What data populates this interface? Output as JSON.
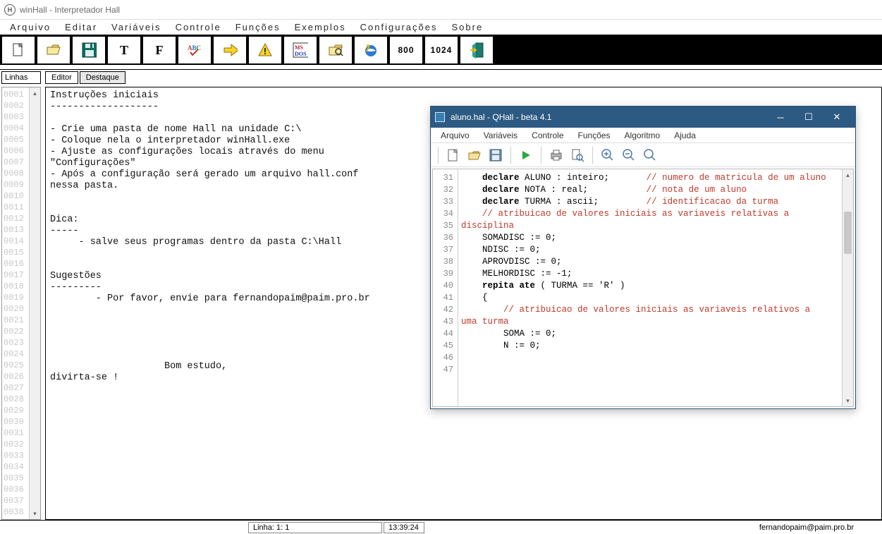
{
  "window": {
    "title": "winHall - Interpretador Hall"
  },
  "menu": [
    "Arquivo",
    "Editar",
    "Variáveis",
    "Controle",
    "Funções",
    "Exemplos",
    "Configurações",
    "Sobre"
  ],
  "toolbar": {
    "btn_800": "800",
    "btn_1024": "1024",
    "btn_T": "T",
    "btn_F": "F"
  },
  "linesTab": "Linhas",
  "lineNumbers": [
    "0001",
    "0002",
    "0003",
    "0004",
    "0005",
    "0006",
    "0007",
    "0008",
    "0009",
    "0010",
    "0011",
    "0012",
    "0013",
    "0014",
    "0015",
    "0016",
    "0017",
    "0018",
    "0019",
    "0020",
    "0021",
    "0022",
    "0023",
    "0024",
    "0025",
    "0026",
    "0027",
    "0028",
    "0029",
    "0030",
    "0031",
    "0032",
    "0033",
    "0034",
    "0035",
    "0036",
    "0037",
    "0038"
  ],
  "tabs": {
    "editor": "Editor",
    "destaque": "Destaque"
  },
  "editorText": "Instruções iniciais\n-------------------\n\n- Crie uma pasta de nome Hall na unidade C:\\\n- Coloque nela o interpretador winHall.exe\n- Ajuste as configurações locais através do menu\n\"Configurações\"\n- Após a configuração será gerado um arquivo hall.conf\nnessa pasta.\n\n\nDica:\n-----\n     - salve seus programas dentro da pasta C:\\Hall\n\n\nSugestões\n---------\n        - Por favor, envie para fernandopaim@paim.pro.br\n\n\n\n\n\n                    Bom estudo,\ndivirta-se !",
  "status": {
    "line": "Linha: 1: 1",
    "time": "13:39:24",
    "email": "fernandopaim@paim.pro.br"
  },
  "qhall": {
    "title": "aluno.hal - QHall - beta 4.1",
    "menu": [
      "Arquivo",
      "Variáveis",
      "Controle",
      "Funções",
      "Algoritmo",
      "Ajuda"
    ],
    "gutter": [
      "31",
      "32",
      "33",
      "34",
      "35",
      "36",
      "37",
      "38",
      "39",
      "40",
      "41",
      "42",
      "43",
      "44",
      "",
      "45",
      "46",
      "47"
    ],
    "code": [
      {
        "indent": "    ",
        "parts": [
          {
            "t": "declare ",
            "c": "kw"
          },
          {
            "t": "ALUNO : inteiro;",
            "c": "id"
          },
          {
            "t": "       ",
            "c": ""
          },
          {
            "t": "// numero de matricula de um aluno",
            "c": "cm"
          }
        ]
      },
      {
        "indent": "    ",
        "parts": [
          {
            "t": "declare ",
            "c": "kw"
          },
          {
            "t": "NOTA : real;",
            "c": "id"
          },
          {
            "t": "           ",
            "c": ""
          },
          {
            "t": "// nota de um aluno",
            "c": "cm"
          }
        ]
      },
      {
        "indent": "    ",
        "parts": [
          {
            "t": "declare ",
            "c": "kw"
          },
          {
            "t": "TURMA : ascii;",
            "c": "id"
          },
          {
            "t": "         ",
            "c": ""
          },
          {
            "t": "// identificacao da turma",
            "c": "cm"
          }
        ]
      },
      {
        "indent": "",
        "parts": [
          {
            "t": "",
            "c": ""
          }
        ]
      },
      {
        "indent": "    ",
        "parts": [
          {
            "t": "// atribuicao de valores iniciais as variaveis relativas a",
            "c": "cm"
          }
        ]
      },
      {
        "indent": "",
        "parts": [
          {
            "t": "disciplina",
            "c": "cm"
          }
        ]
      },
      {
        "indent": "",
        "parts": [
          {
            "t": "",
            "c": ""
          }
        ]
      },
      {
        "indent": "    ",
        "parts": [
          {
            "t": "SOMADISC := 0;",
            "c": "id"
          }
        ]
      },
      {
        "indent": "    ",
        "parts": [
          {
            "t": "NDISC := 0;",
            "c": "id"
          }
        ]
      },
      {
        "indent": "    ",
        "parts": [
          {
            "t": "APROVDISC := 0;",
            "c": "id"
          }
        ]
      },
      {
        "indent": "    ",
        "parts": [
          {
            "t": "MELHORDISC := -1;",
            "c": "id"
          }
        ]
      },
      {
        "indent": "",
        "parts": [
          {
            "t": "",
            "c": ""
          }
        ]
      },
      {
        "indent": "    ",
        "parts": [
          {
            "t": "repita ate ",
            "c": "kw"
          },
          {
            "t": "( TURMA == 'R' )",
            "c": "id"
          }
        ]
      },
      {
        "indent": "    ",
        "parts": [
          {
            "t": "{",
            "c": "id"
          }
        ]
      },
      {
        "indent": "        ",
        "parts": [
          {
            "t": "// atribuicao de valores iniciais as variaveis relativos a",
            "c": "cm"
          }
        ]
      },
      {
        "indent": "",
        "parts": [
          {
            "t": "uma turma",
            "c": "cm"
          }
        ]
      },
      {
        "indent": "",
        "parts": [
          {
            "t": "",
            "c": ""
          }
        ]
      },
      {
        "indent": "        ",
        "parts": [
          {
            "t": "SOMA := 0;",
            "c": "id"
          }
        ]
      },
      {
        "indent": "        ",
        "parts": [
          {
            "t": "N := 0;",
            "c": "id"
          }
        ]
      }
    ]
  }
}
